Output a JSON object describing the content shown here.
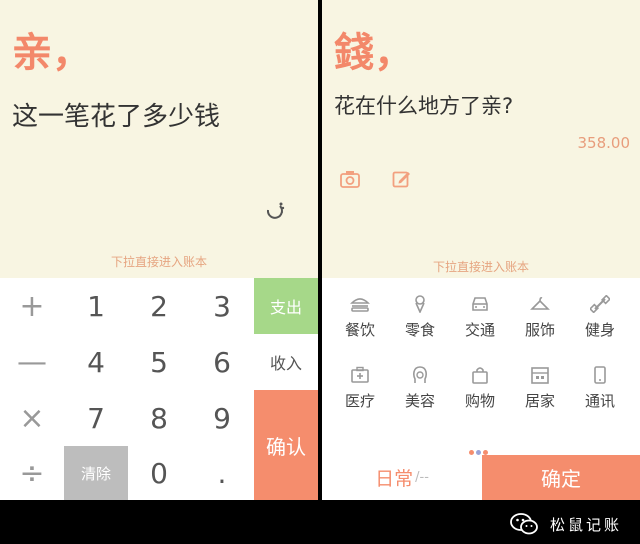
{
  "left": {
    "title": "亲，",
    "question": "这一笔花了多少钱",
    "hint": "下拉直接进入账本",
    "keys": {
      "plus": "+",
      "minus": "—",
      "times": "×",
      "divide": "÷",
      "one": "1",
      "two": "2",
      "three": "3",
      "four": "4",
      "five": "5",
      "six": "6",
      "seven": "7",
      "eight": "8",
      "nine": "9",
      "zero": "0",
      "dot": ".",
      "clear": "清除",
      "expense": "支出",
      "income": "收入",
      "confirm": "确认"
    }
  },
  "right": {
    "title": "錢，",
    "question": "花在什么地方了亲?",
    "amount": "358.00",
    "hint": "下拉直接进入账本",
    "categories": [
      {
        "label": "餐饮",
        "icon": "burger-icon"
      },
      {
        "label": "零食",
        "icon": "icecream-icon"
      },
      {
        "label": "交通",
        "icon": "car-icon"
      },
      {
        "label": "服饰",
        "icon": "hanger-icon"
      },
      {
        "label": "健身",
        "icon": "dumbbell-icon"
      },
      {
        "label": "医疗",
        "icon": "medkit-icon"
      },
      {
        "label": "美容",
        "icon": "face-icon"
      },
      {
        "label": "购物",
        "icon": "bag-icon"
      },
      {
        "label": "居家",
        "icon": "house-icon"
      },
      {
        "label": "通讯",
        "icon": "phone-icon"
      }
    ],
    "mode": "日常",
    "mode_suffix": "/--",
    "ok": "确定"
  },
  "watermark": "松鼠记账",
  "colors": {
    "accent": "#f58d6d",
    "expense_green": "#a6d889",
    "top_bg": "#f8f5e2",
    "clear_gray": "#bdbdbd",
    "dots": [
      "#f58d6d",
      "#9aa4d8",
      "#f58d6d"
    ]
  }
}
